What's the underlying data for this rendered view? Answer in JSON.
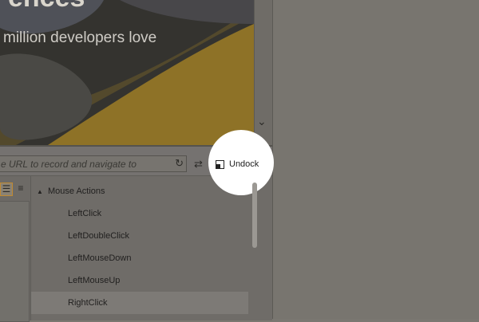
{
  "hero": {
    "title_fragment": "ences",
    "subtitle": "million developers love"
  },
  "recorder": {
    "url_placeholder": "e URL to record and navigate to",
    "undock_label": "Undock",
    "tree": {
      "group_label": "Mouse Actions",
      "items": [
        "LeftClick",
        "LeftDoubleClick",
        "LeftMouseDown",
        "LeftMouseUp",
        "RightClick"
      ],
      "selected_item": "RightClick"
    }
  },
  "colors": {
    "accent_yellow": "#9c7a26",
    "selected_row": "#7d7a76",
    "spotlight": "#ffffff"
  }
}
